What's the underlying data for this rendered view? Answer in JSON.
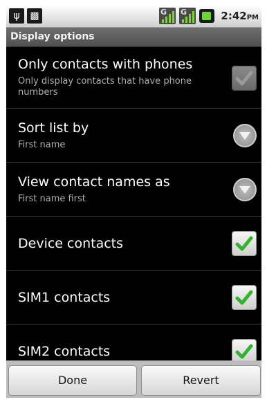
{
  "status_bar": {
    "icons": [
      "usb-icon",
      "android-icon"
    ],
    "signal_label": "G",
    "time": "2:42",
    "ampm": "PM"
  },
  "title": "Display options",
  "rows": [
    {
      "title": "Only contacts with phones",
      "subtitle": "Only display contacts that have phone numbers",
      "control": "checkbox",
      "checked": true,
      "enabled": false
    },
    {
      "title": "Sort list by",
      "subtitle": "First name",
      "control": "dropdown"
    },
    {
      "title": "View contact names as",
      "subtitle": "First name first",
      "control": "dropdown"
    },
    {
      "title": "Device contacts",
      "control": "checkbox",
      "checked": true,
      "enabled": true
    },
    {
      "title": "SIM1 contacts",
      "control": "checkbox",
      "checked": true,
      "enabled": true
    },
    {
      "title": "SIM2 contacts",
      "control": "checkbox",
      "checked": true,
      "enabled": true
    }
  ],
  "buttons": {
    "done": "Done",
    "revert": "Revert"
  },
  "colors": {
    "check_green": "#35b32e",
    "background": "#000000"
  }
}
